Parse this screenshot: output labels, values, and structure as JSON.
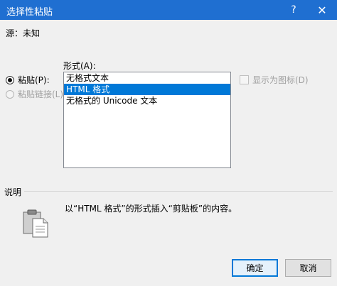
{
  "window": {
    "title": "选择性粘贴",
    "help_label": "?",
    "close_label": "✕"
  },
  "source": {
    "text": "源：未知"
  },
  "format_label": "形式(A):",
  "options": [
    {
      "label": "粘贴(P):",
      "checked": true,
      "enabled": true
    },
    {
      "label": "粘贴链接(L):",
      "checked": false,
      "enabled": false
    }
  ],
  "formats": [
    {
      "label": "无格式文本",
      "selected": false
    },
    {
      "label": "HTML 格式",
      "selected": true
    },
    {
      "label": "无格式的 Unicode 文本",
      "selected": false
    }
  ],
  "show_as_icon": {
    "label": "显示为图标(D)",
    "checked": false,
    "enabled": false
  },
  "description": {
    "label": "说明",
    "text": "以“HTML 格式”的形式插入“剪贴板”的内容。"
  },
  "buttons": {
    "ok": "确定",
    "cancel": "取消"
  },
  "colors": {
    "titlebar": "#1f6fd1",
    "selection": "#0078d7"
  }
}
